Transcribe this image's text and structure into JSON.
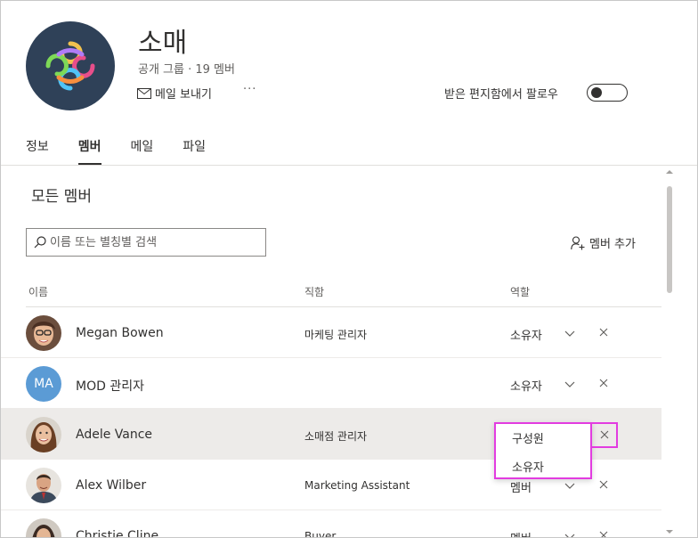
{
  "group": {
    "name": "소매",
    "subtitle": "공개 그룹 · 19 멤버",
    "send_email": "메일 보내기",
    "more": "···",
    "follow_label": "받은 편지함에서 팔로우",
    "follow_enabled": false
  },
  "tabs": [
    {
      "label": "정보",
      "active": false
    },
    {
      "label": "멤버",
      "active": true
    },
    {
      "label": "메일",
      "active": false
    },
    {
      "label": "파일",
      "active": false
    }
  ],
  "members_section": {
    "title": "모든 멤버",
    "search_placeholder": "이름 또는 별칭별 검색",
    "add_member": "멤버 추가",
    "columns": {
      "name": "이름",
      "title": "직함",
      "role": "역할"
    }
  },
  "members": [
    {
      "name": "Megan Bowen",
      "title": "마케팅 관리자",
      "role": "소유자",
      "avatar": "photo"
    },
    {
      "name": "MOD 관리자",
      "title": "",
      "role": "소유자",
      "avatar": "initials",
      "initials": "MA"
    },
    {
      "name": "Adele Vance",
      "title": "소매점 관리자",
      "role": "",
      "avatar": "photo",
      "highlighted": true
    },
    {
      "name": "Alex Wilber",
      "title": "Marketing Assistant",
      "role": "멤버",
      "avatar": "photo"
    },
    {
      "name": "Christie Cline",
      "title": "Buyer",
      "role": "멤버",
      "avatar": "photo"
    }
  ],
  "role_dropdown": {
    "options": [
      "구성원",
      "소유자"
    ]
  },
  "icons": {
    "mail": "mail-icon",
    "search": "search-icon",
    "add_person": "add-person-icon",
    "chevron": "chevron-down-icon",
    "remove": "close-icon"
  },
  "colors": {
    "accent_highlight": "#e23ce0",
    "initials_avatar": "#5b9bd5",
    "group_avatar_bg": "#2f4158"
  }
}
